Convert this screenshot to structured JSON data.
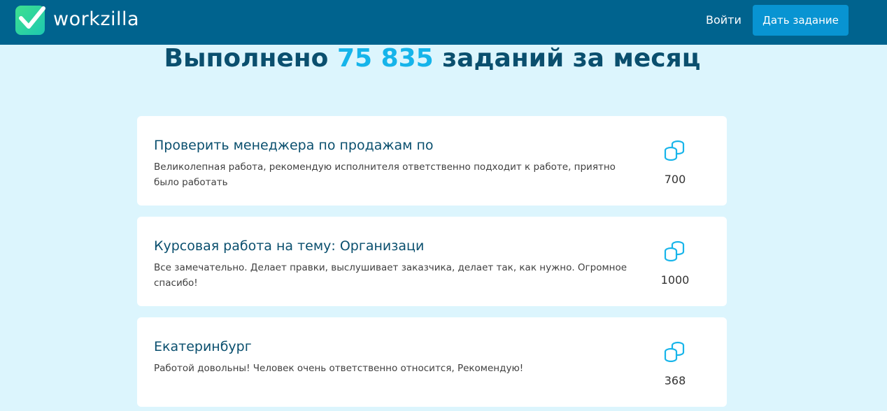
{
  "header": {
    "logo_text": "workzilla",
    "login_label": "Войти",
    "give_task_label": "Дать задание"
  },
  "headline": {
    "prefix": "Выполнено ",
    "count": "75 835",
    "suffix": " заданий за месяц"
  },
  "colors": {
    "header_bg": "#00638e",
    "page_bg": "#dcf5fd",
    "accent": "#15b4ea",
    "button_bg": "#0894d2",
    "title_text": "#0a4f6e"
  },
  "tasks": [
    {
      "title": "Проверить менеджера по продажам по",
      "review": "Великолепная работа, рекомендую исполнителя ответственно подходит к работе, приятно было работать",
      "price": "700",
      "icon": "coins-icon"
    },
    {
      "title": "Курсовая работа на тему: Организаци",
      "review": "Все замечательно. Делает правки, выслушивает заказчика, делает так, как нужно. Огромное спасибо!",
      "price": "1000",
      "icon": "coins-icon"
    },
    {
      "title": "Екатеринбург",
      "review": "Работой довольны! Человек очень ответственно относится, Рекомендую!",
      "price": "368",
      "icon": "coins-icon"
    }
  ]
}
